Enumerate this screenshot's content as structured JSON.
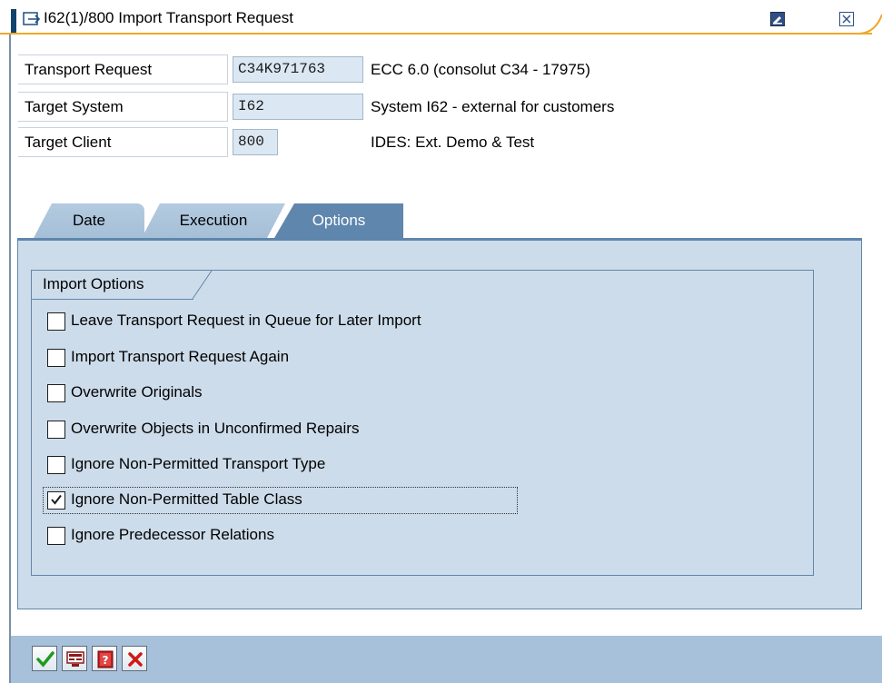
{
  "window": {
    "title": "I62(1)/800 Import Transport Request"
  },
  "header": {
    "transport_request": {
      "label": "Transport Request",
      "value": "C34K971763",
      "description": "ECC 6.0 (consolut C34 - 17975)"
    },
    "target_system": {
      "label": "Target System",
      "value": "I62",
      "description": "System I62 - external for customers"
    },
    "target_client": {
      "label": "Target Client",
      "value": "800",
      "description": "IDES: Ext. Demo & Test"
    }
  },
  "tabs": [
    {
      "label": "Date",
      "active": false
    },
    {
      "label": "Execution",
      "active": false
    },
    {
      "label": "Options",
      "active": true
    }
  ],
  "import_options": {
    "title": "Import Options",
    "items": [
      {
        "label": "Leave Transport Request in Queue for Later Import",
        "checked": false
      },
      {
        "label": "Import Transport Request Again",
        "checked": false
      },
      {
        "label": "Overwrite Originals",
        "checked": false
      },
      {
        "label": "Overwrite Objects in Unconfirmed Repairs",
        "checked": false
      },
      {
        "label": "Ignore Non-Permitted Transport Type",
        "checked": false
      },
      {
        "label": "Ignore Non-Permitted Table Class",
        "checked": true
      },
      {
        "label": "Ignore Predecessor Relations",
        "checked": false
      }
    ]
  },
  "toolbar": {
    "buttons": [
      {
        "icon": "checkmark-icon"
      },
      {
        "icon": "display-icon"
      },
      {
        "icon": "help-icon"
      },
      {
        "icon": "cancel-icon"
      }
    ]
  },
  "colors": {
    "panel": "#cddcea",
    "active_tab": "#5f86ad",
    "toolbar": "#a8c1da",
    "input_bg": "#dbe7f3"
  }
}
